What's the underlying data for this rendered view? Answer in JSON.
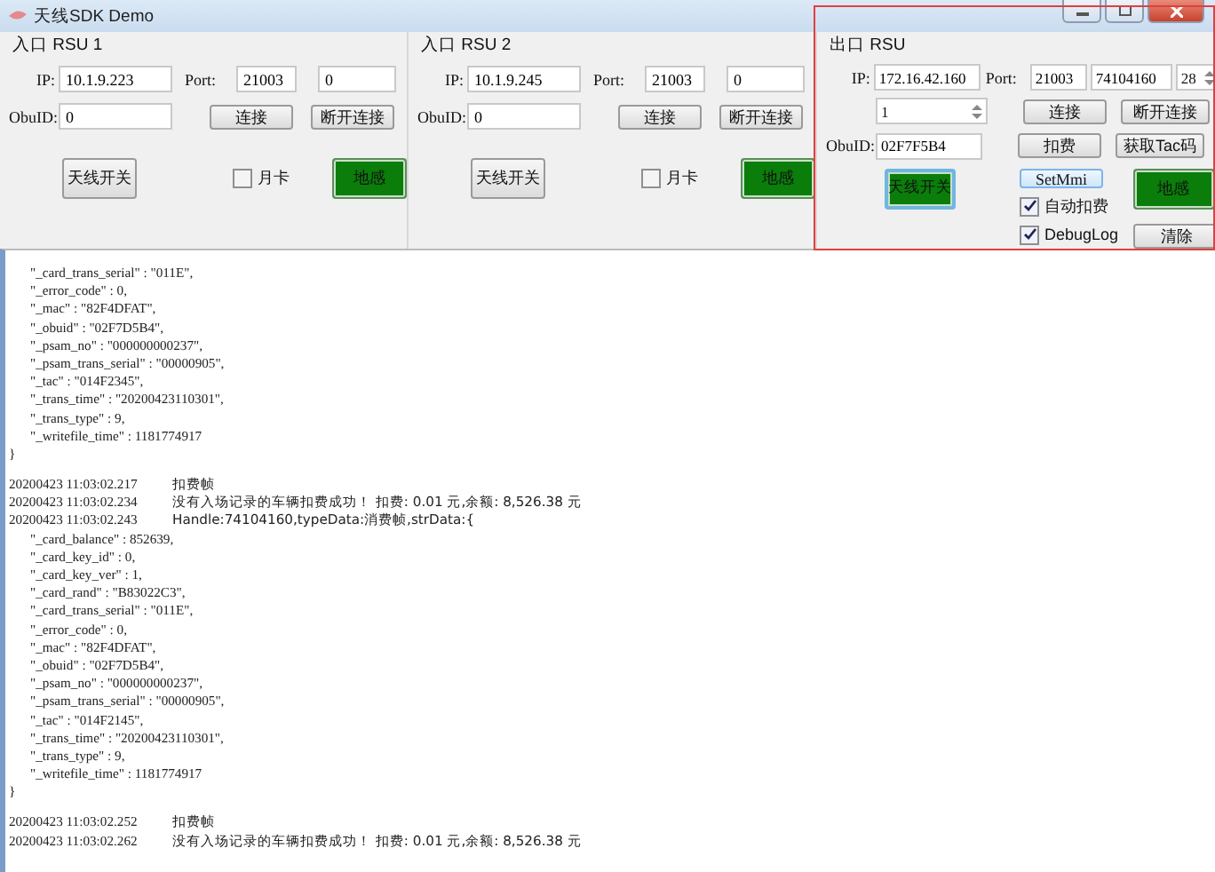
{
  "window": {
    "title": "天线SDK Demo"
  },
  "entry_panels": [
    {
      "title": "入口 RSU 1",
      "ip_label": "IP:",
      "ip": "10.1.9.223",
      "port_label": "Port:",
      "port": "21003",
      "extra": "0",
      "obuid_label": "ObuID:",
      "obuid": "0",
      "connect": "连接",
      "disconnect": "断开连接",
      "antenna": {
        "label": "天线开关",
        "active": false
      },
      "monthly_card": {
        "label": "月卡",
        "checked": false
      },
      "ground": {
        "label": "地感",
        "active": true
      }
    },
    {
      "title": "入口 RSU 2",
      "ip_label": "IP:",
      "ip": "10.1.9.245",
      "port_label": "Port:",
      "port": "21003",
      "extra": "0",
      "obuid_label": "ObuID:",
      "obuid": "0",
      "connect": "连接",
      "disconnect": "断开连接",
      "antenna": {
        "label": "天线开关",
        "active": false
      },
      "monthly_card": {
        "label": "月卡",
        "checked": false
      },
      "ground": {
        "label": "地感",
        "active": true
      }
    }
  ],
  "exit_panel": {
    "title": "出口 RSU",
    "highlighted": true,
    "ip_label": "IP:",
    "ip": "172.16.42.160",
    "port_label": "Port:",
    "port": "21003",
    "handle": "74104160",
    "spin": "28",
    "count": "1",
    "obuid_label": "ObuID:",
    "obuid": "02F7F5B4",
    "connect": "连接",
    "disconnect": "断开连接",
    "charge": "扣费",
    "get_tac": "获取Tac码",
    "antenna": {
      "label": "天线开关",
      "active": true
    },
    "set_mmi": "SetMmi",
    "ground": {
      "label": "地感",
      "active": true
    },
    "auto_charge": {
      "label": "自动扣费",
      "checked": true
    },
    "debug_log": {
      "label": "DebugLog",
      "checked": true
    },
    "clear": "清除"
  },
  "log": [
    {
      "kind": "field",
      "text": "\"_card_trans_serial\" : \"011E\","
    },
    {
      "kind": "field",
      "text": "\"_error_code\" : 0,"
    },
    {
      "kind": "field",
      "text": "\"_mac\" : \"82F4DFAT\","
    },
    {
      "kind": "field",
      "text": "\"_obuid\" : \"02F7D5B4\","
    },
    {
      "kind": "field",
      "text": "\"_psam_no\" : \"000000000237\","
    },
    {
      "kind": "field",
      "text": "\"_psam_trans_serial\" : \"00000905\","
    },
    {
      "kind": "field",
      "text": "\"_tac\" : \"014F2345\","
    },
    {
      "kind": "field",
      "text": "\"_trans_time\" : \"20200423110301\","
    },
    {
      "kind": "field",
      "text": "\"_trans_type\" : 9,"
    },
    {
      "kind": "field",
      "text": "\"_writefile_time\" : 1181774917"
    },
    {
      "kind": "brace",
      "text": "}"
    },
    {
      "kind": "blank"
    },
    {
      "kind": "entry",
      "time": "20200423 11:03:02.217",
      "message": "扣费帧"
    },
    {
      "kind": "entry",
      "time": "20200423 11:03:02.234",
      "message": "没有入场记录的车辆扣费成功！ 扣费: 0.01 元,余额: 8,526.38 元"
    },
    {
      "kind": "entry",
      "time": "20200423 11:03:02.243",
      "message": "Handle:74104160,typeData:消费帧,strData:{"
    },
    {
      "kind": "field",
      "text": "\"_card_balance\" : 852639,"
    },
    {
      "kind": "field",
      "text": "\"_card_key_id\" : 0,"
    },
    {
      "kind": "field",
      "text": "\"_card_key_ver\" : 1,"
    },
    {
      "kind": "field",
      "text": "\"_card_rand\" : \"B83022C3\","
    },
    {
      "kind": "field",
      "text": "\"_card_trans_serial\" : \"011E\","
    },
    {
      "kind": "field",
      "text": "\"_error_code\" : 0,"
    },
    {
      "kind": "field",
      "text": "\"_mac\" : \"82F4DFAT\","
    },
    {
      "kind": "field",
      "text": "\"_obuid\" : \"02F7D5B4\","
    },
    {
      "kind": "field",
      "text": "\"_psam_no\" : \"000000000237\","
    },
    {
      "kind": "field",
      "text": "\"_psam_trans_serial\" : \"00000905\","
    },
    {
      "kind": "field",
      "text": "\"_tac\" : \"014F2145\","
    },
    {
      "kind": "field",
      "text": "\"_trans_time\" : \"20200423110301\","
    },
    {
      "kind": "field",
      "text": "\"_trans_type\" : 9,"
    },
    {
      "kind": "field",
      "text": "\"_writefile_time\" : 1181774917"
    },
    {
      "kind": "brace",
      "text": "}"
    },
    {
      "kind": "blank"
    },
    {
      "kind": "entry",
      "time": "20200423 11:03:02.252",
      "message": "扣费帧"
    },
    {
      "kind": "entry",
      "time": "20200423 11:03:02.262",
      "message": "没有入场记录的车辆扣费成功！ 扣费: 0.01 元,余额: 8,526.38 元"
    }
  ]
}
